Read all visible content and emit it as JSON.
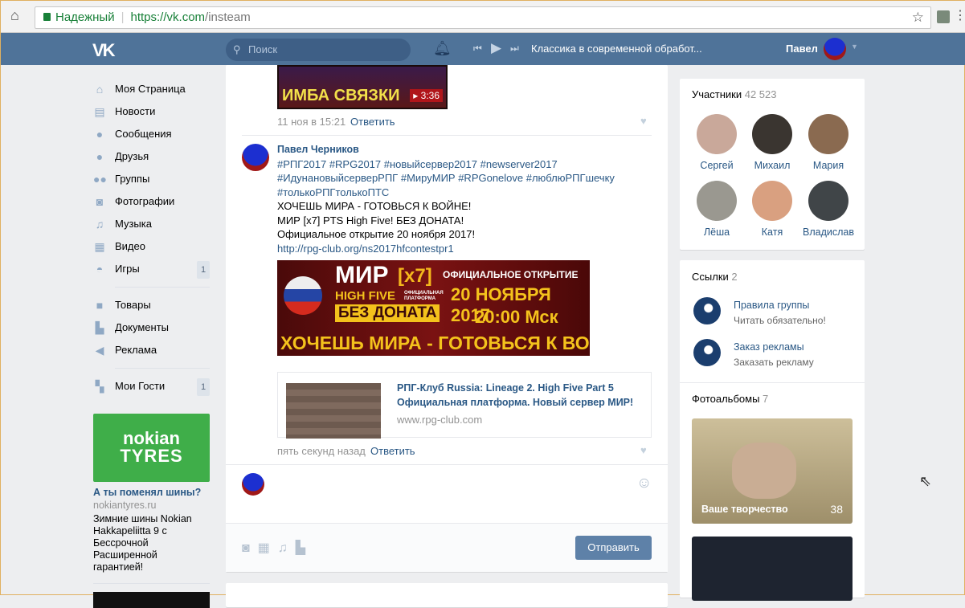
{
  "browser": {
    "secure_label": "Надежный",
    "url_host": "https://vk.com",
    "url_path": "/insteam"
  },
  "header": {
    "search_placeholder": "Поиск",
    "track": "Классика в современной обработ...",
    "user_name": "Павел"
  },
  "sidebar": {
    "items": [
      {
        "label": "Моя Страница",
        "icon": "home-icon"
      },
      {
        "label": "Новости",
        "icon": "news-icon"
      },
      {
        "label": "Сообщения",
        "icon": "messages-icon"
      },
      {
        "label": "Друзья",
        "icon": "user-icon"
      },
      {
        "label": "Группы",
        "icon": "groups-icon"
      },
      {
        "label": "Фотографии",
        "icon": "camera-icon"
      },
      {
        "label": "Музыка",
        "icon": "music-icon"
      },
      {
        "label": "Видео",
        "icon": "video-icon"
      },
      {
        "label": "Игры",
        "icon": "gamepad-icon",
        "badge": "1"
      }
    ],
    "items2": [
      {
        "label": "Товары"
      },
      {
        "label": "Документы"
      },
      {
        "label": "Реклама"
      }
    ],
    "guests": {
      "label": "Мои Гости",
      "badge": "1"
    },
    "ad": {
      "logo_top": "nokian",
      "logo_bottom": "TYRES",
      "title": "А ты поменял шины?",
      "domain": "nokiantyres.ru",
      "text": "Зимние шины Nokian Hakkapeliitta 9 с Бессрочной Расширенной гарантией!"
    }
  },
  "feed": {
    "prev_comment": {
      "video_text": "ИМБА СВЯЗКИ",
      "duration": "3:36",
      "time": "11 ноя в 15:21",
      "reply": "Ответить"
    },
    "comment": {
      "author": "Павел Черников",
      "hashtags_line1": "#РПГ2017 #RPG2017 #новыйсервер2017 #newserver2017",
      "hashtags_line2": "#ИдунановыйсерверРПГ #МируМИР #RPGonelove #люблюРПГшечку",
      "hashtags_line3": "#толькоРПГтолькоПТС",
      "line1": "ХОЧЕШЬ МИРА - ГОТОВЬСЯ К ВОЙНЕ!",
      "line2": "МИР [x7] PTS High Five! БЕЗ ДОНАТА!",
      "line3": "Официальное открытие 20 ноября 2017!",
      "link": "http://rpg-club.org/ns2017hfcontestpr1",
      "banner": {
        "mir": "МИР",
        "x7": "[x7]",
        "hf": "HIGH FIVE",
        "platform": "ОФИЦИАЛЬНАЯ ПЛАТФОРМА",
        "nodonate": "БЕЗ ДОНАТА",
        "opening": "ОФИЦИАЛЬНОЕ ОТКРЫТИЕ",
        "date": "20 НОЯБРЯ 2017",
        "time": "20:00 Мск",
        "slogan": "ХОЧЕШЬ МИРА - ГОТОВЬСЯ К ВОЙНЕ"
      },
      "card": {
        "title": "РПГ-Клуб Russia: Lineage 2. High Five Part 5 Официальная платформа. Новый сервер МИР!",
        "domain": "www.rpg-club.com"
      },
      "time": "пять секунд назад",
      "reply": "Ответить"
    },
    "composer": {
      "send": "Отправить"
    }
  },
  "right": {
    "members": {
      "title": "Участники",
      "count": "42 523",
      "people": [
        {
          "name": "Сергей",
          "color": "#c9a89a"
        },
        {
          "name": "Михаил",
          "color": "#3a3530"
        },
        {
          "name": "Мария",
          "color": "#8a6a50"
        },
        {
          "name": "Лёша",
          "color": "#9a9890"
        },
        {
          "name": "Катя",
          "color": "#d9a080"
        },
        {
          "name": "Владислав",
          "color": "#404548"
        }
      ]
    },
    "links": {
      "title": "Ссылки",
      "count": "2",
      "items": [
        {
          "title": "Правила группы",
          "sub": "Читать обязательно!"
        },
        {
          "title": "Заказ рекламы",
          "sub": "Заказать рекламу"
        }
      ]
    },
    "albums": {
      "title": "Фотоальбомы",
      "count": "7",
      "first": {
        "name": "Ваше творчество",
        "count": "38"
      }
    }
  }
}
